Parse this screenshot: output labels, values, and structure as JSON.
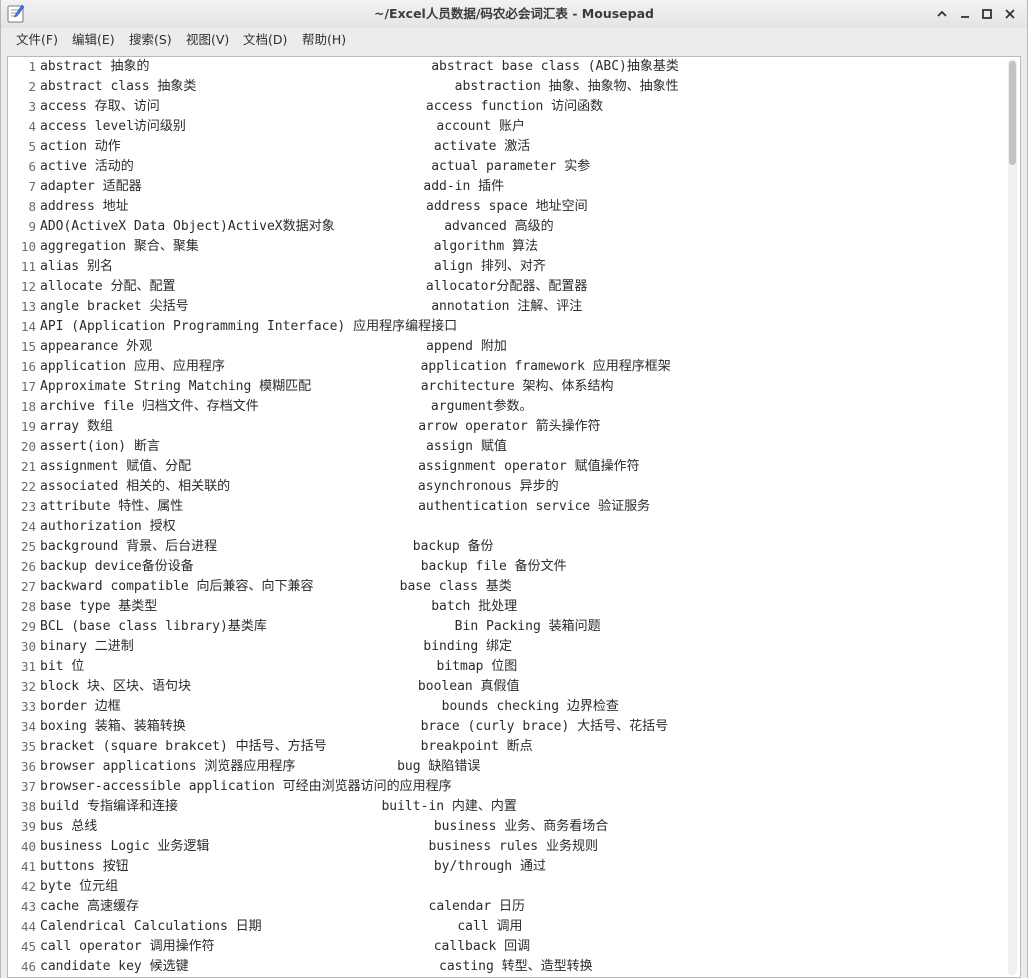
{
  "window": {
    "title": "~/Excel人员数据/码农必会词汇表 - Mousepad"
  },
  "menu": [
    {
      "label": "文件(F)"
    },
    {
      "label": "编辑(E)"
    },
    {
      "label": "搜索(S)"
    },
    {
      "label": "视图(V)"
    },
    {
      "label": "文档(D)"
    },
    {
      "label": "帮助(H)"
    }
  ],
  "lines": [
    {
      "num": "1",
      "text": "abstract 抽象的                                    abstract base class (ABC)抽象基类"
    },
    {
      "num": "2",
      "text": "abstract class 抽象类                                 abstraction 抽象、抽象物、抽象性"
    },
    {
      "num": "3",
      "text": "access 存取、访问                                  access function 访问函数"
    },
    {
      "num": "4",
      "text": "access level访问级别                                account 账户"
    },
    {
      "num": "5",
      "text": "action 动作                                        activate 激活"
    },
    {
      "num": "6",
      "text": "active 活动的                                      actual parameter 实参"
    },
    {
      "num": "7",
      "text": "adapter 适配器                                    add-in 插件"
    },
    {
      "num": "8",
      "text": "address 地址                                      address space 地址空间"
    },
    {
      "num": "9",
      "text": "ADO(ActiveX Data Object)ActiveX数据对象              advanced 高级的"
    },
    {
      "num": "10",
      "text": "aggregation 聚合、聚集                              algorithm 算法"
    },
    {
      "num": "11",
      "text": "alias 别名                                         align 排列、对齐"
    },
    {
      "num": "12",
      "text": "allocate 分配、配置                                allocator分配器、配置器"
    },
    {
      "num": "13",
      "text": "angle bracket 尖括号                               annotation 注解、评注"
    },
    {
      "num": "14",
      "text": "API (Application Programming Interface) 应用程序编程接口"
    },
    {
      "num": "15",
      "text": "appearance 外观                                   append 附加"
    },
    {
      "num": "16",
      "text": "application 应用、应用程序                         application framework 应用程序框架"
    },
    {
      "num": "17",
      "text": "Approximate String Matching 模糊匹配              architecture 架构、体系结构"
    },
    {
      "num": "18",
      "text": "archive file 归档文件、存档文件                      argument参数。"
    },
    {
      "num": "19",
      "text": "array 数组                                       arrow operator 箭头操作符"
    },
    {
      "num": "20",
      "text": "assert(ion) 断言                                  assign 赋值"
    },
    {
      "num": "21",
      "text": "assignment 赋值、分配                             assignment operator 赋值操作符"
    },
    {
      "num": "22",
      "text": "associated 相关的、相关联的                        asynchronous 异步的"
    },
    {
      "num": "23",
      "text": "attribute 特性、属性                              authentication service 验证服务"
    },
    {
      "num": "24",
      "text": "authorization 授权"
    },
    {
      "num": "25",
      "text": "background 背景、后台进程                         backup 备份"
    },
    {
      "num": "26",
      "text": "backup device备份设备                             backup file 备份文件"
    },
    {
      "num": "27",
      "text": "backward compatible 向后兼容、向下兼容           base class 基类"
    },
    {
      "num": "28",
      "text": "base type 基类型                                   batch 批处理"
    },
    {
      "num": "29",
      "text": "BCL (base class library)基类库                        Bin Packing 装箱问题"
    },
    {
      "num": "30",
      "text": "binary 二进制                                     binding 绑定"
    },
    {
      "num": "31",
      "text": "bit 位                                             bitmap 位图"
    },
    {
      "num": "32",
      "text": "block 块、区块、语句块                             boolean 真假值"
    },
    {
      "num": "33",
      "text": "border 边框                                         bounds checking 边界检查"
    },
    {
      "num": "34",
      "text": "boxing 装箱、装箱转换                              brace (curly brace) 大括号、花括号"
    },
    {
      "num": "35",
      "text": "bracket (square brakcet) 中括号、方括号            breakpoint 断点"
    },
    {
      "num": "36",
      "text": "browser applications 浏览器应用程序             bug 缺陷错误"
    },
    {
      "num": "37",
      "text": "browser-accessible application 可经由浏览器访问的应用程序"
    },
    {
      "num": "38",
      "text": "build 专指编译和连接                          built-in 内建、内置"
    },
    {
      "num": "39",
      "text": "bus 总线                                           business 业务、商务看场合"
    },
    {
      "num": "40",
      "text": "business Logic 业务逻辑                            business rules 业务规则"
    },
    {
      "num": "41",
      "text": "buttons 按钮                                       by/through 通过"
    },
    {
      "num": "42",
      "text": "byte 位元组"
    },
    {
      "num": "43",
      "text": "cache 高速缓存                                     calendar 日历"
    },
    {
      "num": "44",
      "text": "Calendrical Calculations 日期                         call 调用"
    },
    {
      "num": "45",
      "text": "call operator 调用操作符                            callback 回调"
    },
    {
      "num": "46",
      "text": "candidate key 候选键                                casting 转型、造型转换"
    }
  ]
}
